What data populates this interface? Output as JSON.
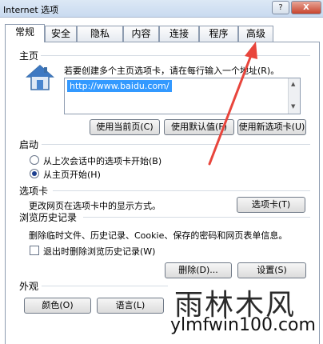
{
  "window": {
    "title": "Internet 选项",
    "help_label": "?",
    "close_label": "X"
  },
  "tabs": [
    "常规",
    "安全",
    "隐私",
    "内容",
    "连接",
    "程序",
    "高级"
  ],
  "home": {
    "section": "主页",
    "instruction": "若要创建多个主页选项卡，请在每行输入一个地址(R)。",
    "url": "http://www.baidu.com/",
    "buttons": {
      "current": "使用当前页(C)",
      "default": "使用默认值(F)",
      "new_tab": "使用新选项卡(U)"
    }
  },
  "startup": {
    "section": "启动",
    "option_last_session": "从上次会话中的选项卡开始(B)",
    "option_home": "从主页开始(H)",
    "selected": "option_home"
  },
  "tabs_section": {
    "section": "选项卡",
    "description": "更改网页在选项卡中的显示方式。",
    "button": "选项卡(T)"
  },
  "history": {
    "section": "浏览历史记录",
    "description": "删除临时文件、历史记录、Cookie、保存的密码和网页表单信息。",
    "checkbox": "退出时删除浏览历史记录(W)",
    "checked": false,
    "delete_button": "删除(D)...",
    "settings_button": "设置(S)"
  },
  "appearance": {
    "section": "外观",
    "colors_button": "颜色(O)",
    "languages_button": "语言(L)"
  },
  "watermark": {
    "brand": "雨林木风",
    "site": "ylmfwin100.com"
  },
  "colors": {
    "accent_arrow": "#e8453c",
    "selection": "#3399ff"
  }
}
